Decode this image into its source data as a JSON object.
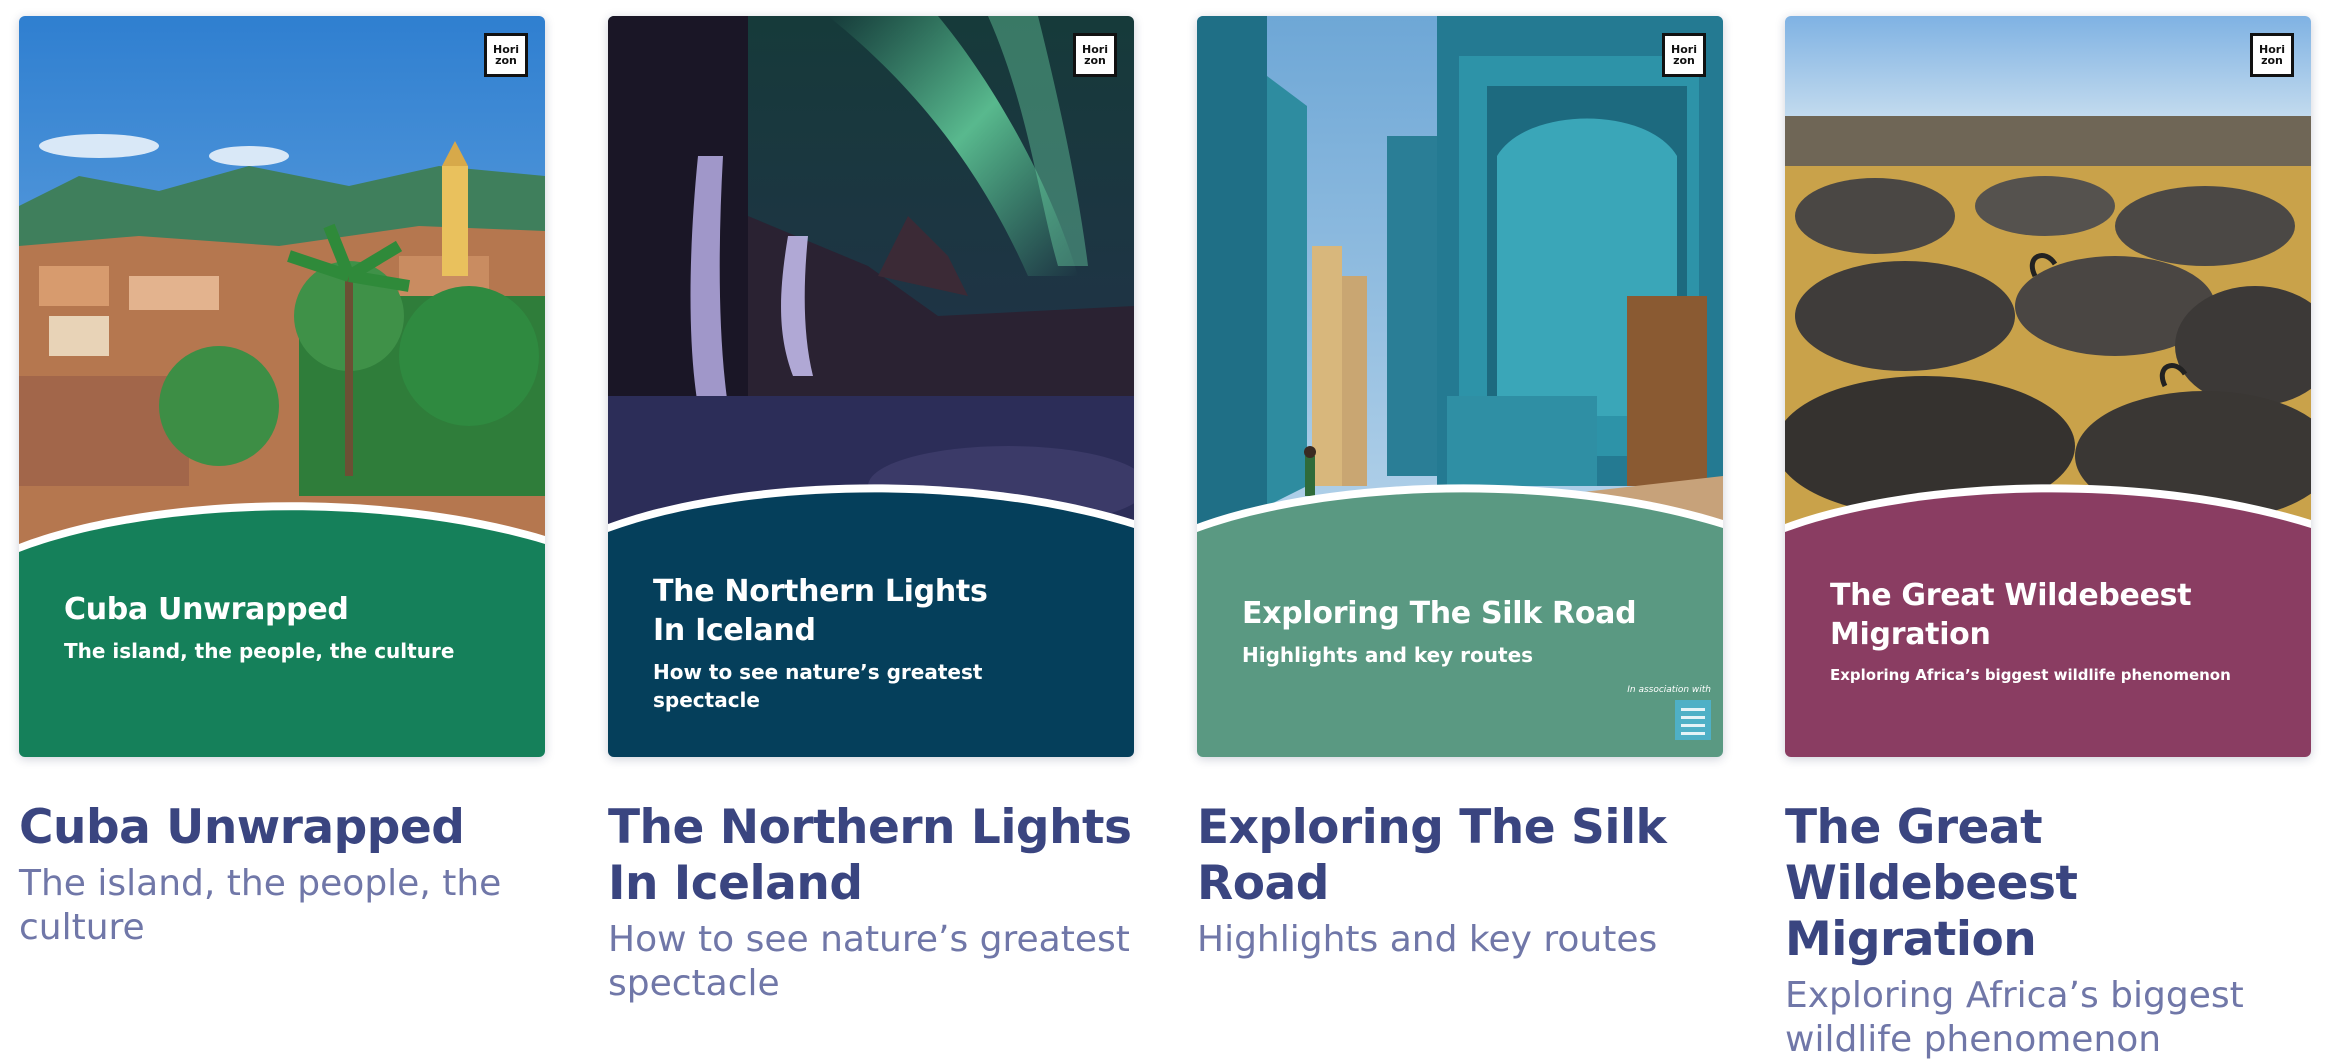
{
  "brand": {
    "logo_text": "Horizon",
    "title_color": "#3a4580",
    "subtitle_color": "#7077a8"
  },
  "guides": [
    {
      "title": "Cuba Unwrapped",
      "subtitle": "The island, the people, the culture",
      "band_color": "#15805a",
      "image": "colonial-town-with-bell-tower-and-palm-trees"
    },
    {
      "title": "The Northern Lights In Iceland",
      "cover_title_line1": "The Northern Lights",
      "cover_title_line2": "In Iceland",
      "subtitle": "How to see nature’s greatest spectacle",
      "band_color": "#053f5b",
      "image": "waterfall-under-aurora-borealis"
    },
    {
      "title": "Exploring The Silk Road",
      "subtitle": "Highlights and key routes",
      "band_color": "#5a9982",
      "image": "tiled-mausoleum-street-samarkand",
      "association_label": "In association with",
      "partner_logo": "partner-logo"
    },
    {
      "title": "The Great Wildebeest Migration",
      "cover_title_line1": "The Great Wildebeest",
      "cover_title_line2": "Migration",
      "subtitle": "Exploring Africa’s biggest wildlife phenomenon",
      "band_color": "#8a3d62",
      "image": "wildebeest-herd-on-savanna"
    }
  ]
}
